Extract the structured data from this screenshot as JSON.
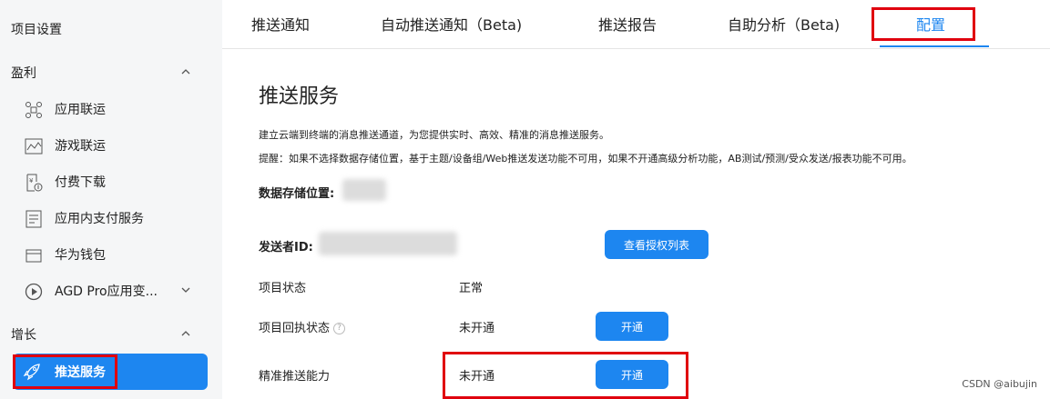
{
  "sidebar": {
    "project_settings": "项目设置",
    "group_monetize": "盈利",
    "group_growth": "增长",
    "items": [
      {
        "label": "应用联运",
        "icon": "app-joint-icon"
      },
      {
        "label": "游戏联运",
        "icon": "game-joint-icon"
      },
      {
        "label": "付费下载",
        "icon": "paid-download-icon"
      },
      {
        "label": "应用内支付服务",
        "icon": "in-app-payment-icon"
      },
      {
        "label": "华为钱包",
        "icon": "wallet-icon"
      },
      {
        "label": "AGD Pro应用变...",
        "icon": "play-circle-icon"
      }
    ],
    "active_item": {
      "label": "推送服务",
      "icon": "rocket-icon"
    }
  },
  "tabs": [
    {
      "label": "推送通知"
    },
    {
      "label": "自动推送通知（Beta)"
    },
    {
      "label": "推送报告"
    },
    {
      "label": "自助分析（Beta)"
    },
    {
      "label": "配置",
      "active": true
    }
  ],
  "main": {
    "title": "推送服务",
    "desc1": "建立云端到终端的消息推送通道，为您提供实时、高效、精准的消息推送服务。",
    "desc2": "提醒：如果不选择数据存储位置，基于主题/设备组/Web推送发送功能不可用，如果不开通高级分析功能，AB测试/预测/受众发送/报表功能不可用。",
    "storage_label": "数据存储位置:",
    "sender_label": "发送者ID:",
    "auth_button": "查看授权列表",
    "status_label": "项目状态",
    "status_value": "正常",
    "receipt_label": "项目回执状态",
    "receipt_value": "未开通",
    "receipt_button": "开通",
    "precise_label": "精准推送能力",
    "precise_value": "未开通",
    "precise_button": "开通"
  },
  "watermark": "CSDN @aibujin",
  "colors": {
    "accent": "#1d86f0",
    "highlight": "#e0000e",
    "sidebar_bg": "#f5f6f7"
  }
}
